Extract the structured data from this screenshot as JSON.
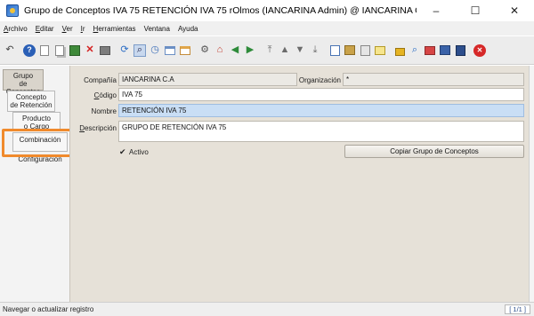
{
  "window": {
    "title": "Grupo de Conceptos  IVA 75  RETENCIÓN IVA 75  rOlmos (IANCARINA Admin) @ IANCARINA C.A.ADMINIS...",
    "minimize": "–",
    "maximize": "☐",
    "close": "✕"
  },
  "menu": {
    "archivo": {
      "mnemonic": "A",
      "rest": "rchivo"
    },
    "editar": {
      "mnemonic": "E",
      "rest": "ditar"
    },
    "ver": {
      "mnemonic": "V",
      "rest": "er"
    },
    "ir": {
      "mnemonic": "I",
      "rest": "r"
    },
    "herramientas": {
      "mnemonic": "H",
      "rest": "erramientas"
    },
    "ventana": {
      "label": "Ventana"
    },
    "ayuda": {
      "label": "Ayuda"
    }
  },
  "toolbar_icons": [
    "undo-icon",
    "help-icon",
    "new-icon",
    "copy-icon",
    "save-icon",
    "delete-icon",
    "print-icon",
    "refresh-icon",
    "find-icon",
    "history-icon",
    "menu-icon",
    "grid-toggle-icon",
    "settings-icon",
    "home-icon",
    "back-icon",
    "forward-icon",
    "first-record-icon",
    "previous-record-icon",
    "next-record-icon",
    "last-record-icon",
    "report-icon",
    "archive-icon",
    "attachment-icon",
    "chat-icon",
    "lock-icon",
    "zoom-across-icon",
    "request-icon",
    "workflow-icon",
    "exit-icon"
  ],
  "tabs": {
    "grupo": "Grupo\nde Conceptos",
    "concepto": "Concepto\nde Retención",
    "producto": "Producto\no Cargo",
    "combinacion": "Combinación",
    "configuracion": "Configuración"
  },
  "form": {
    "compania_label": "Compañía",
    "compania_value": "IANCARINA C.A",
    "organizacion_label": "Organización",
    "organizacion_value": "*",
    "codigo_label_mn": "C",
    "codigo_label_rest": "ódigo",
    "codigo_value": "IVA 75",
    "nombre_label": "Nombre",
    "nombre_value": "RETENCIÓN IVA 75",
    "descripcion_label_mn": "D",
    "descripcion_label_rest": "escripción",
    "descripcion_value": "GRUPO DE RETENCIÓN IVA 75",
    "activo_label": "Activo",
    "activo_checked": "✔",
    "copiar_button": "Copiar Grupo de Conceptos"
  },
  "status": {
    "message": "Navegar o actualizar registro",
    "record_count": "[ 1/1 ]"
  }
}
